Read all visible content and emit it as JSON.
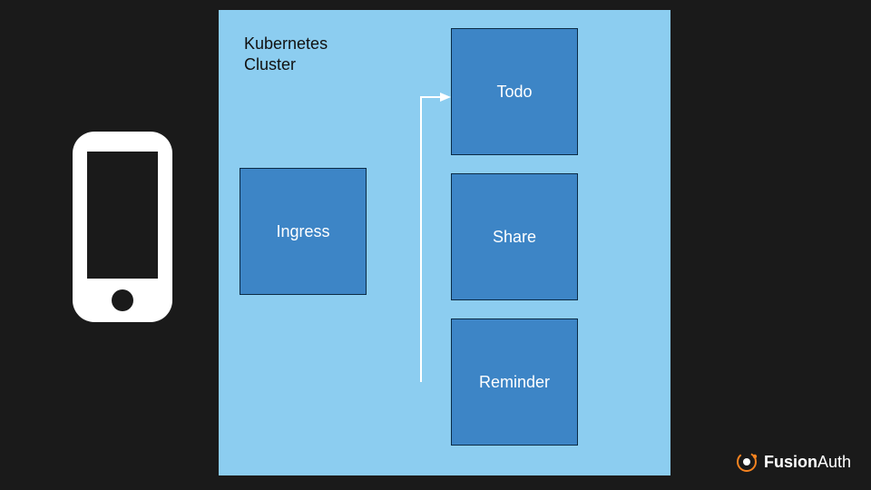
{
  "cluster": {
    "label": "Kubernetes\nCluster",
    "boxes": {
      "ingress": "Ingress",
      "todo": "Todo",
      "share": "Share",
      "reminder": "Reminder"
    }
  },
  "brand": {
    "name_bold": "Fusion",
    "name_light": "Auth"
  }
}
